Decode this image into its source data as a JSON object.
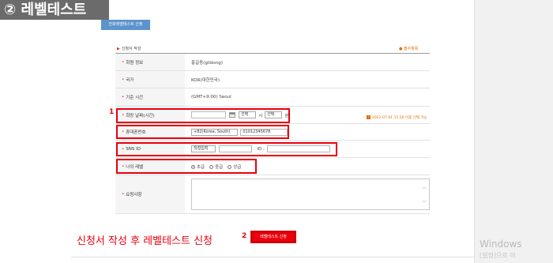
{
  "step_badge": "② 레벨테스트",
  "tab": {
    "label": "전화레벨테스트 신청"
  },
  "form": {
    "title": "신청서 작성",
    "required_note": "● 필수항목",
    "rows": {
      "member": {
        "label": "회원 정보",
        "value": "홍길동(gildong)"
      },
      "country": {
        "label": "국가",
        "value": "KOR(대한민국)"
      },
      "timezone": {
        "label": "기준 시간",
        "value": "(GMT+9:00) Seoul"
      },
      "date": {
        "label": "희망 날짜(시간)",
        "date_value": "",
        "hour_select": "선택",
        "hour_unit": "시",
        "minute_select": "선택",
        "minute_unit": "분",
        "availability_icon": "!",
        "availability_note": "2021-07-01 11:50 이후 선택 가능"
      },
      "phone": {
        "label": "휴대폰번호",
        "country_select": "+82(Korea, South)",
        "number": "01012345678"
      },
      "sns": {
        "label": "SNS ID",
        "type_select": "직접입력",
        "type_value": "",
        "id_label": "ID :",
        "id_value": ""
      },
      "level": {
        "label": "나의 레벨",
        "options": [
          "초급",
          "중급",
          "상급"
        ],
        "selected": "초급"
      },
      "request": {
        "label": "요청사항",
        "value": ""
      }
    }
  },
  "annotations": {
    "step1": "1",
    "step2": "2"
  },
  "bottom": {
    "instruction": "신청서 작성 후 레벨테스트 신청",
    "submit_label": "레벨테스트 신청"
  },
  "windows": {
    "line1": "Windows",
    "line2": "[설정]으로 이"
  },
  "icons": {
    "calendar": "calendar-icon",
    "dropdown": "chevron-down-icon",
    "scroll_up": "scroll-up-icon",
    "scroll_down": "scroll-down-icon"
  },
  "colors": {
    "accent": "#e8000d",
    "tab_blue": "#5d93cc",
    "badge_grey": "#6b6b6b",
    "orange_note": "#e06a00"
  }
}
